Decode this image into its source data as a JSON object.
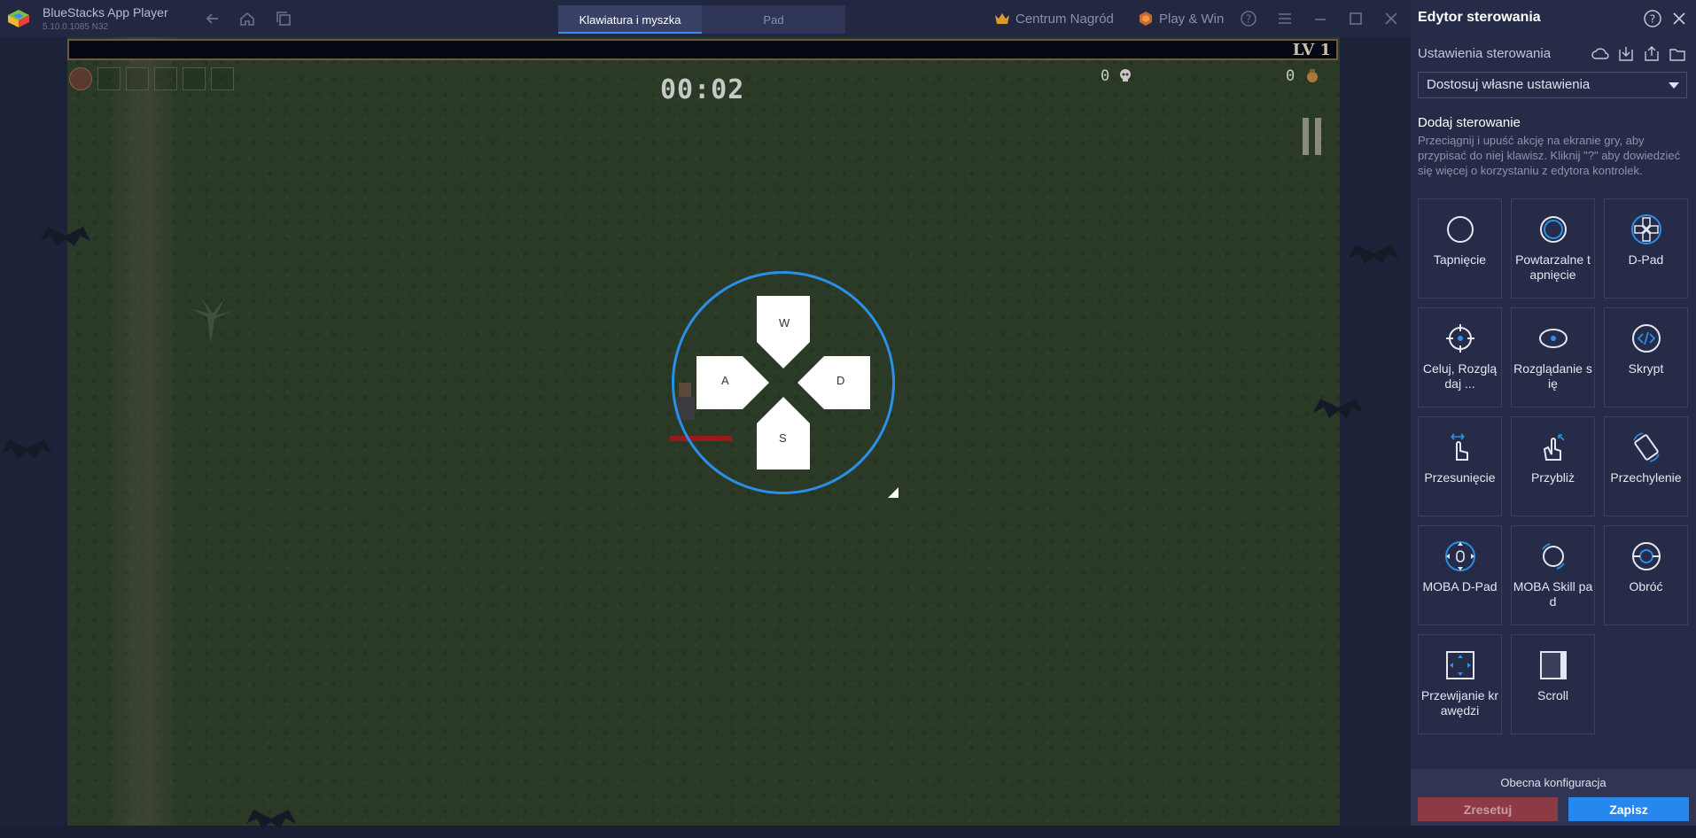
{
  "window": {
    "app_title": "BlueStacks App Player",
    "version": "5.10.0.1085  N32",
    "tabs": [
      {
        "label": "Klawiatura i myszka",
        "active": true
      },
      {
        "label": "Pad",
        "active": false
      }
    ],
    "rewards_label": "Centrum Nagród",
    "playwin_label": "Play & Win"
  },
  "game": {
    "level": "LV 1",
    "timer": "00:02",
    "kills": "0",
    "coins": "0"
  },
  "dpad": {
    "up": "W",
    "left": "A",
    "right": "D",
    "down": "S",
    "ring_color": "#2b8fe8"
  },
  "panel": {
    "title": "Edytor sterowania",
    "settings_label": "Ustawienia sterowania",
    "scheme_selected": "Dostosuj własne ustawienia",
    "add_title": "Dodaj sterowanie",
    "add_desc": "Przeciągnij i upuść akcję na ekranie gry, aby przypisać do niej klawisz. Kliknij \"?\" aby dowiedzieć się więcej o korzystaniu z edytora kontrolek.",
    "tiles": [
      {
        "label": "Tapnięcie",
        "icon": "tap-icon"
      },
      {
        "label": "Powtarzalne tapnięcie",
        "icon": "repeat-tap-icon"
      },
      {
        "label": "D-Pad",
        "icon": "dpad-icon"
      },
      {
        "label": "Celuj, Rozglądaj ...",
        "icon": "aim-icon"
      },
      {
        "label": "Rozglądanie się",
        "icon": "look-around-icon"
      },
      {
        "label": "Skrypt",
        "icon": "script-icon"
      },
      {
        "label": "Przesunięcie",
        "icon": "swipe-icon"
      },
      {
        "label": "Przybliż",
        "icon": "zoom-icon"
      },
      {
        "label": "Przechylenie",
        "icon": "tilt-icon"
      },
      {
        "label": "MOBA D-Pad",
        "icon": "moba-dpad-icon"
      },
      {
        "label": "MOBA Skill pad",
        "icon": "moba-skill-icon"
      },
      {
        "label": "Obróć",
        "icon": "rotate-icon"
      },
      {
        "label": "Przewijanie krawędzi",
        "icon": "edge-scroll-icon"
      },
      {
        "label": "Scroll",
        "icon": "scroll-icon"
      }
    ],
    "current_config": "Obecna konfiguracja",
    "reset_label": "Zresetuj",
    "save_label": "Zapisz",
    "accent": "#2588f0"
  }
}
